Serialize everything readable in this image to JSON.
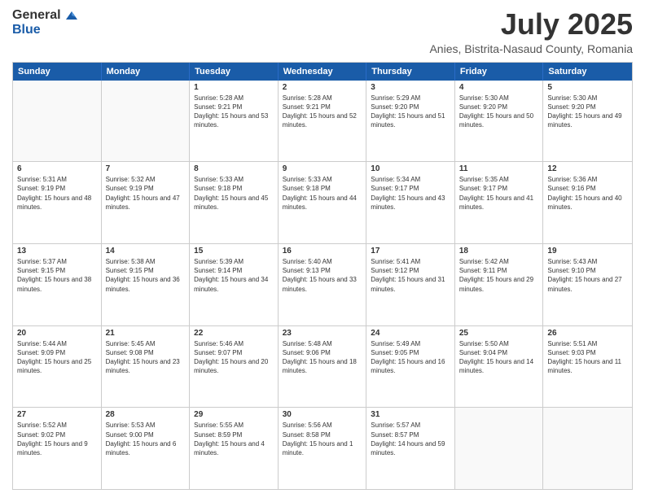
{
  "logo": {
    "general": "General",
    "blue": "Blue"
  },
  "title": "July 2025",
  "subtitle": "Anies, Bistrita-Nasaud County, Romania",
  "headers": [
    "Sunday",
    "Monday",
    "Tuesday",
    "Wednesday",
    "Thursday",
    "Friday",
    "Saturday"
  ],
  "weeks": [
    [
      {
        "day": "",
        "empty": true
      },
      {
        "day": "",
        "empty": true
      },
      {
        "day": "1",
        "sunrise": "5:28 AM",
        "sunset": "9:21 PM",
        "daylight": "15 hours and 53 minutes."
      },
      {
        "day": "2",
        "sunrise": "5:28 AM",
        "sunset": "9:21 PM",
        "daylight": "15 hours and 52 minutes."
      },
      {
        "day": "3",
        "sunrise": "5:29 AM",
        "sunset": "9:20 PM",
        "daylight": "15 hours and 51 minutes."
      },
      {
        "day": "4",
        "sunrise": "5:30 AM",
        "sunset": "9:20 PM",
        "daylight": "15 hours and 50 minutes."
      },
      {
        "day": "5",
        "sunrise": "5:30 AM",
        "sunset": "9:20 PM",
        "daylight": "15 hours and 49 minutes."
      }
    ],
    [
      {
        "day": "6",
        "sunrise": "5:31 AM",
        "sunset": "9:19 PM",
        "daylight": "15 hours and 48 minutes."
      },
      {
        "day": "7",
        "sunrise": "5:32 AM",
        "sunset": "9:19 PM",
        "daylight": "15 hours and 47 minutes."
      },
      {
        "day": "8",
        "sunrise": "5:33 AM",
        "sunset": "9:18 PM",
        "daylight": "15 hours and 45 minutes."
      },
      {
        "day": "9",
        "sunrise": "5:33 AM",
        "sunset": "9:18 PM",
        "daylight": "15 hours and 44 minutes."
      },
      {
        "day": "10",
        "sunrise": "5:34 AM",
        "sunset": "9:17 PM",
        "daylight": "15 hours and 43 minutes."
      },
      {
        "day": "11",
        "sunrise": "5:35 AM",
        "sunset": "9:17 PM",
        "daylight": "15 hours and 41 minutes."
      },
      {
        "day": "12",
        "sunrise": "5:36 AM",
        "sunset": "9:16 PM",
        "daylight": "15 hours and 40 minutes."
      }
    ],
    [
      {
        "day": "13",
        "sunrise": "5:37 AM",
        "sunset": "9:15 PM",
        "daylight": "15 hours and 38 minutes."
      },
      {
        "day": "14",
        "sunrise": "5:38 AM",
        "sunset": "9:15 PM",
        "daylight": "15 hours and 36 minutes."
      },
      {
        "day": "15",
        "sunrise": "5:39 AM",
        "sunset": "9:14 PM",
        "daylight": "15 hours and 34 minutes."
      },
      {
        "day": "16",
        "sunrise": "5:40 AM",
        "sunset": "9:13 PM",
        "daylight": "15 hours and 33 minutes."
      },
      {
        "day": "17",
        "sunrise": "5:41 AM",
        "sunset": "9:12 PM",
        "daylight": "15 hours and 31 minutes."
      },
      {
        "day": "18",
        "sunrise": "5:42 AM",
        "sunset": "9:11 PM",
        "daylight": "15 hours and 29 minutes."
      },
      {
        "day": "19",
        "sunrise": "5:43 AM",
        "sunset": "9:10 PM",
        "daylight": "15 hours and 27 minutes."
      }
    ],
    [
      {
        "day": "20",
        "sunrise": "5:44 AM",
        "sunset": "9:09 PM",
        "daylight": "15 hours and 25 minutes."
      },
      {
        "day": "21",
        "sunrise": "5:45 AM",
        "sunset": "9:08 PM",
        "daylight": "15 hours and 23 minutes."
      },
      {
        "day": "22",
        "sunrise": "5:46 AM",
        "sunset": "9:07 PM",
        "daylight": "15 hours and 20 minutes."
      },
      {
        "day": "23",
        "sunrise": "5:48 AM",
        "sunset": "9:06 PM",
        "daylight": "15 hours and 18 minutes."
      },
      {
        "day": "24",
        "sunrise": "5:49 AM",
        "sunset": "9:05 PM",
        "daylight": "15 hours and 16 minutes."
      },
      {
        "day": "25",
        "sunrise": "5:50 AM",
        "sunset": "9:04 PM",
        "daylight": "15 hours and 14 minutes."
      },
      {
        "day": "26",
        "sunrise": "5:51 AM",
        "sunset": "9:03 PM",
        "daylight": "15 hours and 11 minutes."
      }
    ],
    [
      {
        "day": "27",
        "sunrise": "5:52 AM",
        "sunset": "9:02 PM",
        "daylight": "15 hours and 9 minutes."
      },
      {
        "day": "28",
        "sunrise": "5:53 AM",
        "sunset": "9:00 PM",
        "daylight": "15 hours and 6 minutes."
      },
      {
        "day": "29",
        "sunrise": "5:55 AM",
        "sunset": "8:59 PM",
        "daylight": "15 hours and 4 minutes."
      },
      {
        "day": "30",
        "sunrise": "5:56 AM",
        "sunset": "8:58 PM",
        "daylight": "15 hours and 1 minute."
      },
      {
        "day": "31",
        "sunrise": "5:57 AM",
        "sunset": "8:57 PM",
        "daylight": "14 hours and 59 minutes."
      },
      {
        "day": "",
        "empty": true
      },
      {
        "day": "",
        "empty": true
      }
    ]
  ]
}
